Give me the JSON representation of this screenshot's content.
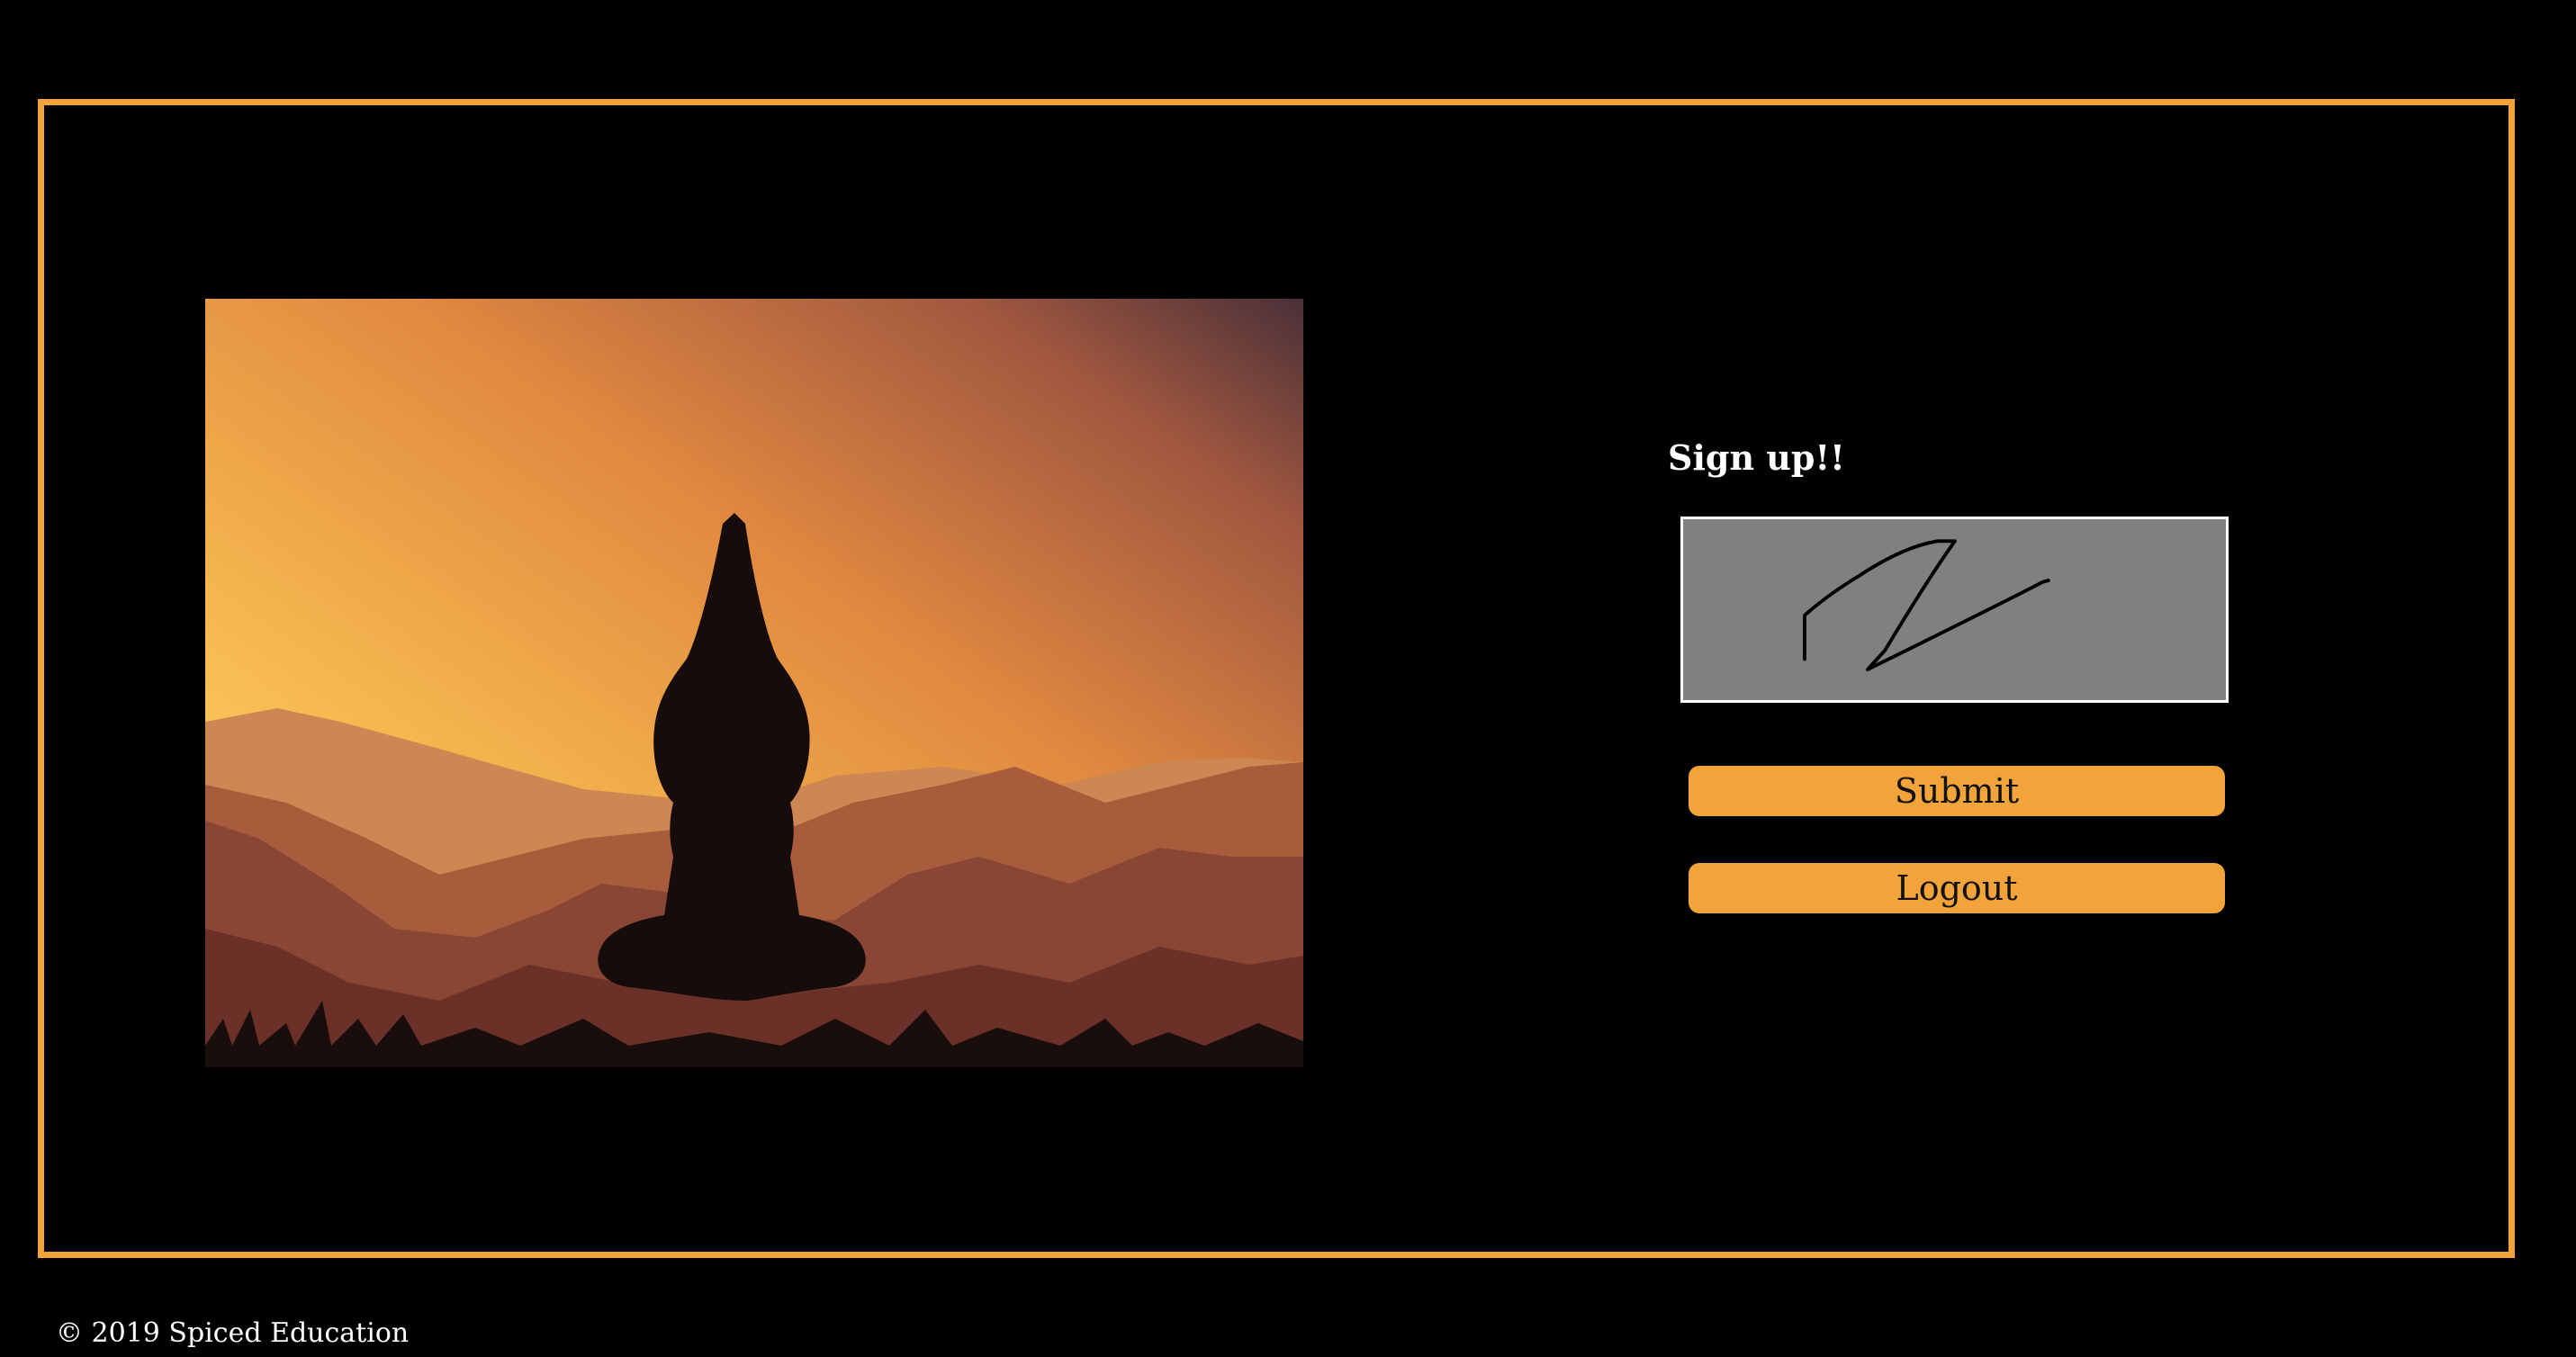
{
  "signup": {
    "heading": "Sign up!!"
  },
  "signature_canvas": {
    "background": "#808080",
    "border_color": "#ffffff",
    "stroke_color": "#000000"
  },
  "buttons": {
    "submit_label": "Submit",
    "logout_label": "Logout",
    "color": "#f2a43a"
  },
  "hero_image": {
    "subject": "yoga-silhouette-sunset"
  },
  "footer": {
    "copyright": "© 2019 Spiced Education"
  },
  "colors": {
    "accent": "#f2a43a",
    "background": "#000000"
  }
}
